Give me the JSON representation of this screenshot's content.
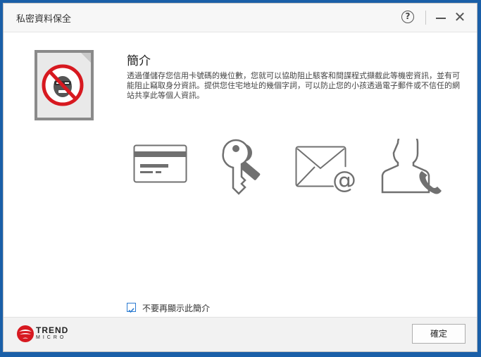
{
  "window": {
    "title": "私密資料保全",
    "help_label": "?",
    "close_label": "✕"
  },
  "intro": {
    "heading": "簡介",
    "description": "透過僅儲存您信用卡號碼的幾位數，您就可以協助阻止駭客和間諜程式擷截此等機密資訊，並有可能阻止竊取身分資訊。提供您住宅地址的幾個字詞，可以防止您的小孩透過電子郵件或不信任的網站共享此等個人資訊。"
  },
  "features": [
    {
      "icon": "credit-card-icon"
    },
    {
      "icon": "key-icon"
    },
    {
      "icon": "email-icon"
    },
    {
      "icon": "contact-phone-icon"
    }
  ],
  "dont_show": {
    "label": "不要再顯示此簡介",
    "checked": true
  },
  "footer": {
    "brand_line1": "TREND",
    "brand_line2": "MICRO",
    "ok_label": "確定"
  },
  "colors": {
    "accent": "#2b7bd1",
    "brand_red": "#d71920",
    "icon_gray": "#707070"
  }
}
